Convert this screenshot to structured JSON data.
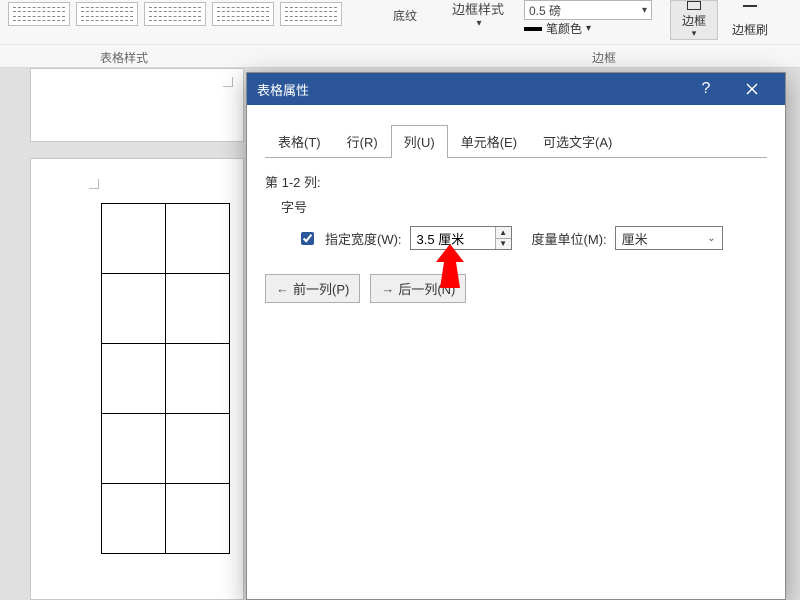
{
  "ribbon": {
    "shading_label": "底纹",
    "border_style_label": "边框样式",
    "pen_color_label": "笔颜色",
    "line_weight": "0.5 磅",
    "border_btn": "边框",
    "border_brush_btn": "边框刷",
    "group_styles": "表格样式",
    "group_border": "边框"
  },
  "dialog": {
    "title": "表格属性",
    "help": "?",
    "tabs": {
      "table": "表格(T)",
      "row": "行(R)",
      "column": "列(U)",
      "cell": "单元格(E)",
      "alt": "可选文字(A)"
    },
    "body": {
      "range_label": "第 1-2 列:",
      "size_label": "字号",
      "specify_width": "指定宽度(W):",
      "width_value": "3.5 厘米",
      "measure_label": "度量单位(M):",
      "measure_value": "厘米",
      "prev": "前一列(P)",
      "next": "后一列(N)"
    }
  }
}
